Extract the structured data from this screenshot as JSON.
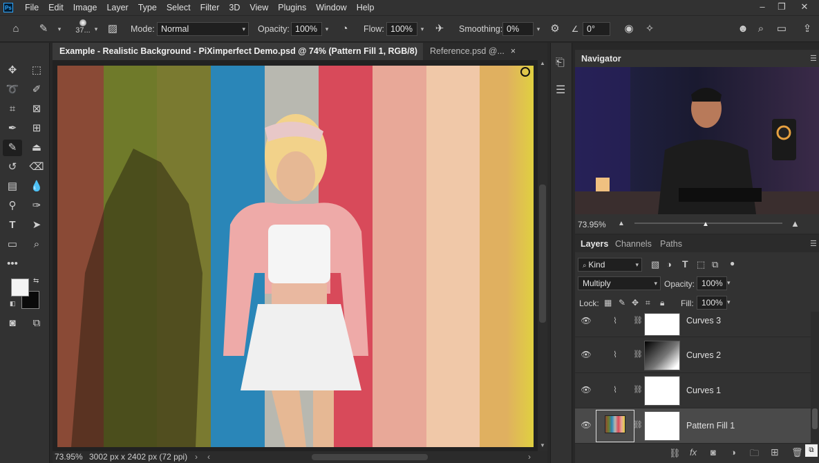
{
  "menu": {
    "logo": "Ps",
    "items": [
      "File",
      "Edit",
      "Image",
      "Layer",
      "Type",
      "Select",
      "Filter",
      "3D",
      "View",
      "Plugins",
      "Window",
      "Help"
    ]
  },
  "options": {
    "brush_size": "37...",
    "mode_label": "Mode:",
    "mode_value": "Normal",
    "opacity_label": "Opacity:",
    "opacity_value": "100%",
    "flow_label": "Flow:",
    "flow_value": "100%",
    "smoothing_label": "Smoothing:",
    "smoothing_value": "0%",
    "angle_value": "0°"
  },
  "tabs": {
    "active": "Example - Realistic Background - PiXimperfect Demo.psd @ 74% (Pattern Fill 1, RGB/8) *",
    "inactive": "Reference.psd @..."
  },
  "status": {
    "zoom": "73.95%",
    "dimensions": "3002 px x 2402 px (72 ppi)"
  },
  "navigator": {
    "title": "Navigator",
    "zoom": "73.95%"
  },
  "layers_panel": {
    "tabs": [
      "Layers",
      "Channels",
      "Paths"
    ],
    "filter_kind": "Kind",
    "blend_mode": "Multiply",
    "opacity_label": "Opacity:",
    "opacity_value": "100%",
    "lock_label": "Lock:",
    "fill_label": "Fill:",
    "fill_value": "100%",
    "layers": [
      {
        "name": "Curves 3"
      },
      {
        "name": "Curves 2"
      },
      {
        "name": "Curves 1"
      },
      {
        "name": "Pattern Fill 1"
      }
    ]
  },
  "colors": {
    "accent": "#31a8ff",
    "stripes": [
      "#8a4a36",
      "#6f7a2a",
      "#7a7a30",
      "#2a86b8",
      "#b8b8b0",
      "#d84a5a",
      "#e8a898",
      "#f0c8a8",
      "#e0b060",
      "#e0d040"
    ]
  }
}
